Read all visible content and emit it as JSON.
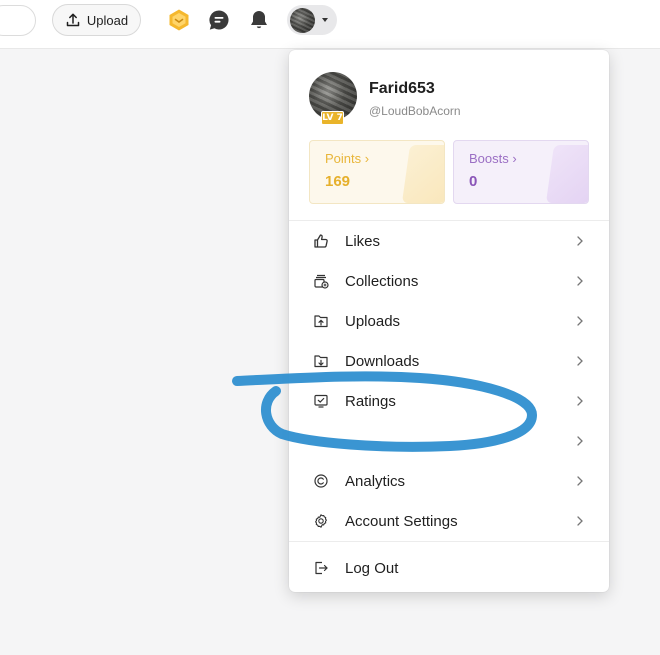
{
  "topbar": {
    "upload_label": "Upload",
    "icons": [
      "upload-icon",
      "hexagon-badge-icon",
      "chat-icon",
      "bell-icon",
      "chevron-down-icon"
    ]
  },
  "profile": {
    "username": "Farid653",
    "handle": "@LoudBobAcorn",
    "level": "LV 7"
  },
  "stats": {
    "points": {
      "label": "Points ›",
      "value": "169"
    },
    "boosts": {
      "label": "Boosts ›",
      "value": "0"
    }
  },
  "menu": {
    "items": [
      {
        "label": "Likes",
        "icon": "thumbs-up-icon"
      },
      {
        "label": "Collections",
        "icon": "collections-icon"
      },
      {
        "label": "Uploads",
        "icon": "upload-folder-icon"
      },
      {
        "label": "Downloads",
        "icon": "download-folder-icon"
      },
      {
        "label": "Ratings",
        "icon": "ratings-icon"
      },
      {
        "label": "",
        "icon": "obscured-icon"
      },
      {
        "label": "Analytics",
        "icon": "analytics-icon"
      },
      {
        "label": "Account Settings",
        "icon": "gear-icon"
      }
    ],
    "logout_label": "Log Out"
  },
  "colors": {
    "points_accent": "#e6b02c",
    "boosts_accent": "#8a55b8",
    "annotation_stroke": "#2f8fd0"
  }
}
